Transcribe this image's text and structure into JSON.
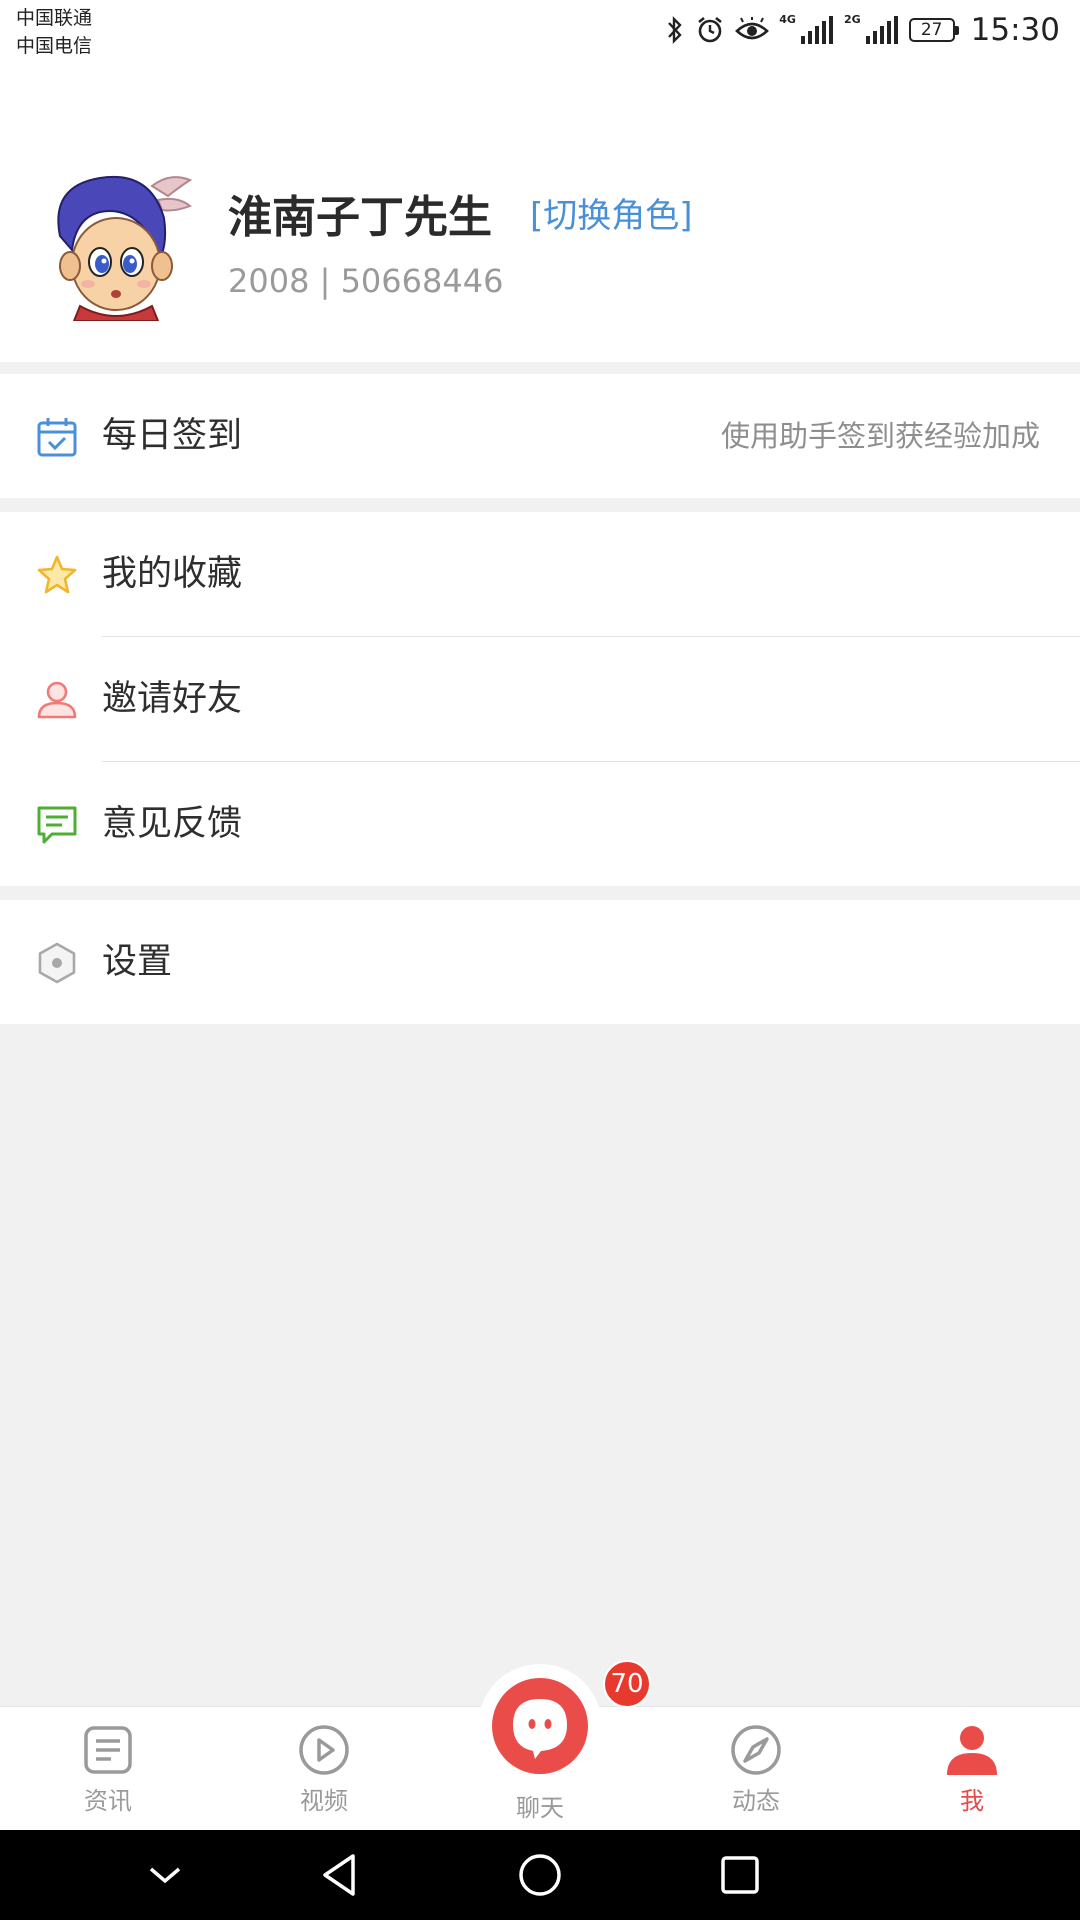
{
  "status_bar": {
    "carrier_1": "中国联通",
    "carrier_2": "中国电信",
    "net_1": "4G",
    "net_2": "2G",
    "battery": "27",
    "time": "15:30"
  },
  "profile": {
    "username": "淮南子丁先生",
    "switch_role": "[切换角色]",
    "meta": "2008 | 50668446"
  },
  "menu": {
    "checkin": {
      "label": "每日签到",
      "hint": "使用助手签到获经验加成",
      "icon": "calendar-check-icon"
    },
    "favorites": {
      "label": "我的收藏",
      "icon": "star-icon"
    },
    "invite": {
      "label": "邀请好友",
      "icon": "person-icon"
    },
    "feedback": {
      "label": "意见反馈",
      "icon": "message-icon"
    },
    "settings": {
      "label": "设置",
      "icon": "hexagon-gear-icon"
    }
  },
  "bottom_nav": {
    "items": [
      {
        "label": "资讯",
        "icon": "news-icon"
      },
      {
        "label": "视频",
        "icon": "play-icon"
      },
      {
        "label": "聊天",
        "icon": "chat-icon"
      },
      {
        "label": "动态",
        "icon": "compass-icon"
      },
      {
        "label": "我",
        "icon": "user-icon"
      }
    ],
    "chat_badge": "70"
  },
  "colors": {
    "accent_red": "#ea4c49",
    "link_blue": "#4a90d9"
  }
}
